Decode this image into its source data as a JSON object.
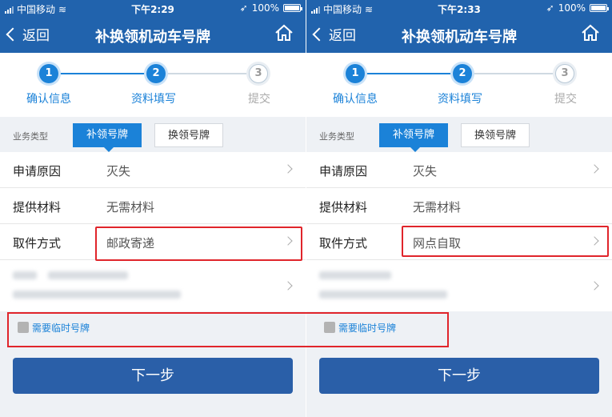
{
  "colors": {
    "header": "#2163ad",
    "accent": "#1b82d8",
    "button": "#2a5fa8",
    "highlight": "#e0252b"
  },
  "screens": [
    {
      "status": {
        "carrier": "中国移动",
        "time": "下午2:29",
        "battery": "100%"
      },
      "nav": {
        "back": "返回",
        "title": "补换领机动车号牌",
        "home_icon": "home-icon"
      },
      "steps": [
        {
          "num": "1",
          "label": "确认信息"
        },
        {
          "num": "2",
          "label": "资料填写"
        },
        {
          "num": "3",
          "label": "提交"
        }
      ],
      "biz": {
        "label": "业务类型",
        "selected": "补领号牌",
        "other": "换领号牌"
      },
      "rows": [
        {
          "label": "申请原因",
          "value": "灭失"
        },
        {
          "label": "提供材料",
          "value": "无需材料"
        },
        {
          "label": "取件方式",
          "value": "邮政寄递"
        }
      ],
      "temp_plate": "需要临时号牌",
      "next": "下一步"
    },
    {
      "status": {
        "carrier": "中国移动",
        "time": "下午2:33",
        "battery": "100%"
      },
      "nav": {
        "back": "返回",
        "title": "补换领机动车号牌",
        "home_icon": "home-icon"
      },
      "steps": [
        {
          "num": "1",
          "label": "确认信息"
        },
        {
          "num": "2",
          "label": "资料填写"
        },
        {
          "num": "3",
          "label": "提交"
        }
      ],
      "biz": {
        "label": "业务类型",
        "selected": "补领号牌",
        "other": "换领号牌"
      },
      "rows": [
        {
          "label": "申请原因",
          "value": "灭失"
        },
        {
          "label": "提供材料",
          "value": "无需材料"
        },
        {
          "label": "取件方式",
          "value": "网点自取"
        }
      ],
      "temp_plate": "需要临时号牌",
      "next": "下一步"
    }
  ]
}
